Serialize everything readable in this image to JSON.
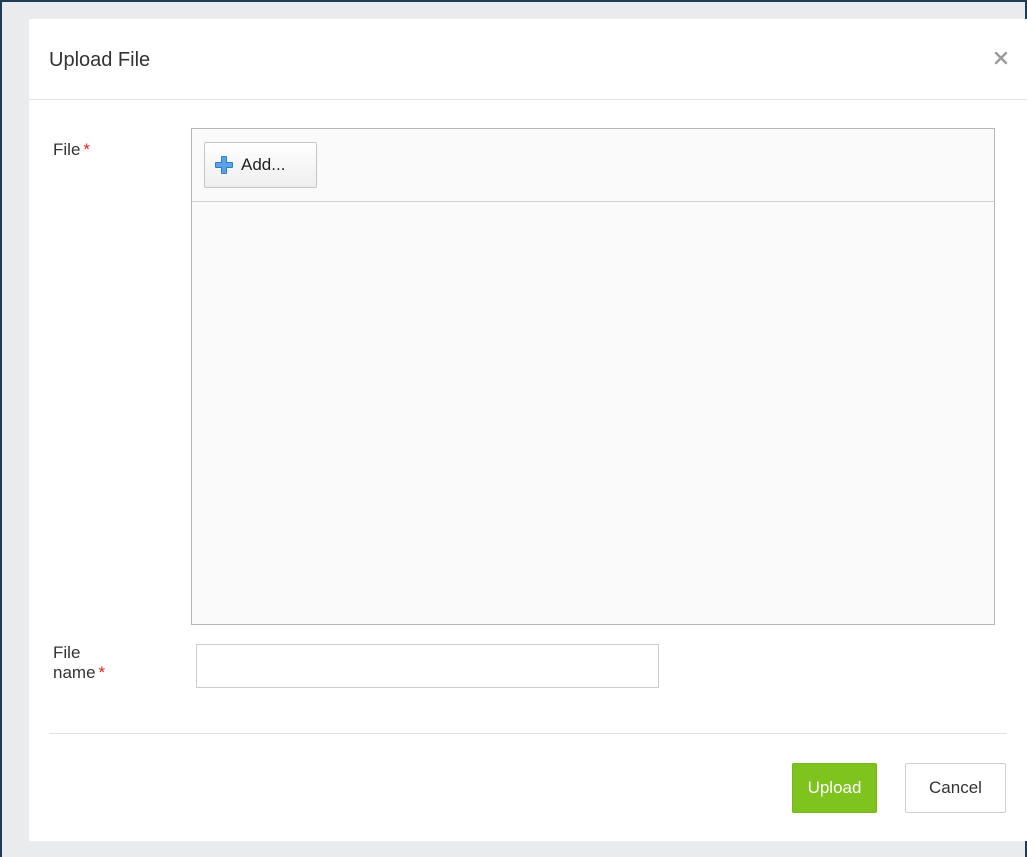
{
  "dialog": {
    "title": "Upload File",
    "close_icon": "close-icon"
  },
  "form": {
    "file_label": "File",
    "required_mark": "*",
    "add_button_label": "Add...",
    "add_icon": "plus-icon",
    "file_name_label_line1": "File",
    "file_name_label_line2": "name",
    "file_name_value": "",
    "file_name_placeholder": ""
  },
  "footer": {
    "upload_label": "Upload",
    "cancel_label": "Cancel"
  },
  "colors": {
    "accent_green": "#7fc31f",
    "required_red": "#e02020",
    "plus_blue": "#2f7fd0"
  }
}
